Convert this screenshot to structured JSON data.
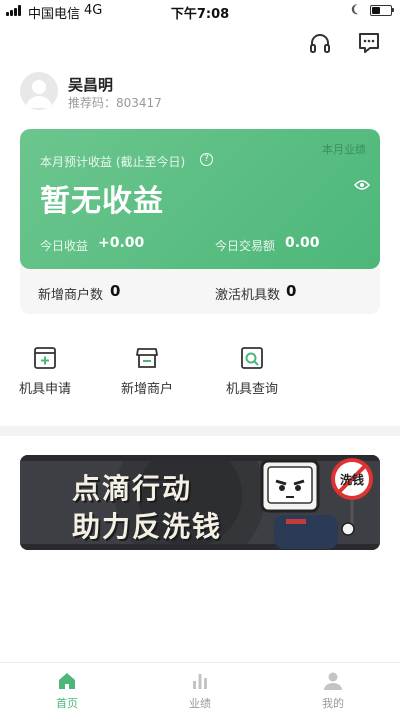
{
  "status_bar": {
    "carrier": "中国电信",
    "network": "4G",
    "time": "下午7:08"
  },
  "header": {
    "headset_icon": "headset-icon",
    "message_icon": "message-icon"
  },
  "profile": {
    "name": "吴昌明",
    "referral_code": "推荐码：803417"
  },
  "earnings_card": {
    "month_tag": "本月业绩",
    "estimated_label": "本月预计收益 (截止至今日)",
    "help_icon": "?",
    "big_value": "暂无收益",
    "today_income_label": "今日收益",
    "today_income_value": "+0.00",
    "today_tx_label": "今日交易额",
    "today_tx_value": "0.00",
    "new_merchants_label": "新增商户数",
    "new_merchants_value": "0",
    "activated_label": "激活机具数",
    "activated_value": "0",
    "accent": "#4cb779"
  },
  "quick_actions": [
    {
      "label": "机具申请",
      "icon": "device-apply-icon"
    },
    {
      "label": "新增商户",
      "icon": "store-icon"
    },
    {
      "label": "机具查询",
      "icon": "device-search-icon"
    }
  ],
  "banner": {
    "line1": "点滴行动",
    "line2": "助力反洗钱",
    "sign_text": "洗钱"
  },
  "tabs": [
    {
      "label": "首页",
      "icon": "home-icon",
      "active": true
    },
    {
      "label": "业绩",
      "icon": "bar-chart-icon",
      "active": false
    },
    {
      "label": "我的",
      "icon": "user-icon",
      "active": false
    }
  ]
}
